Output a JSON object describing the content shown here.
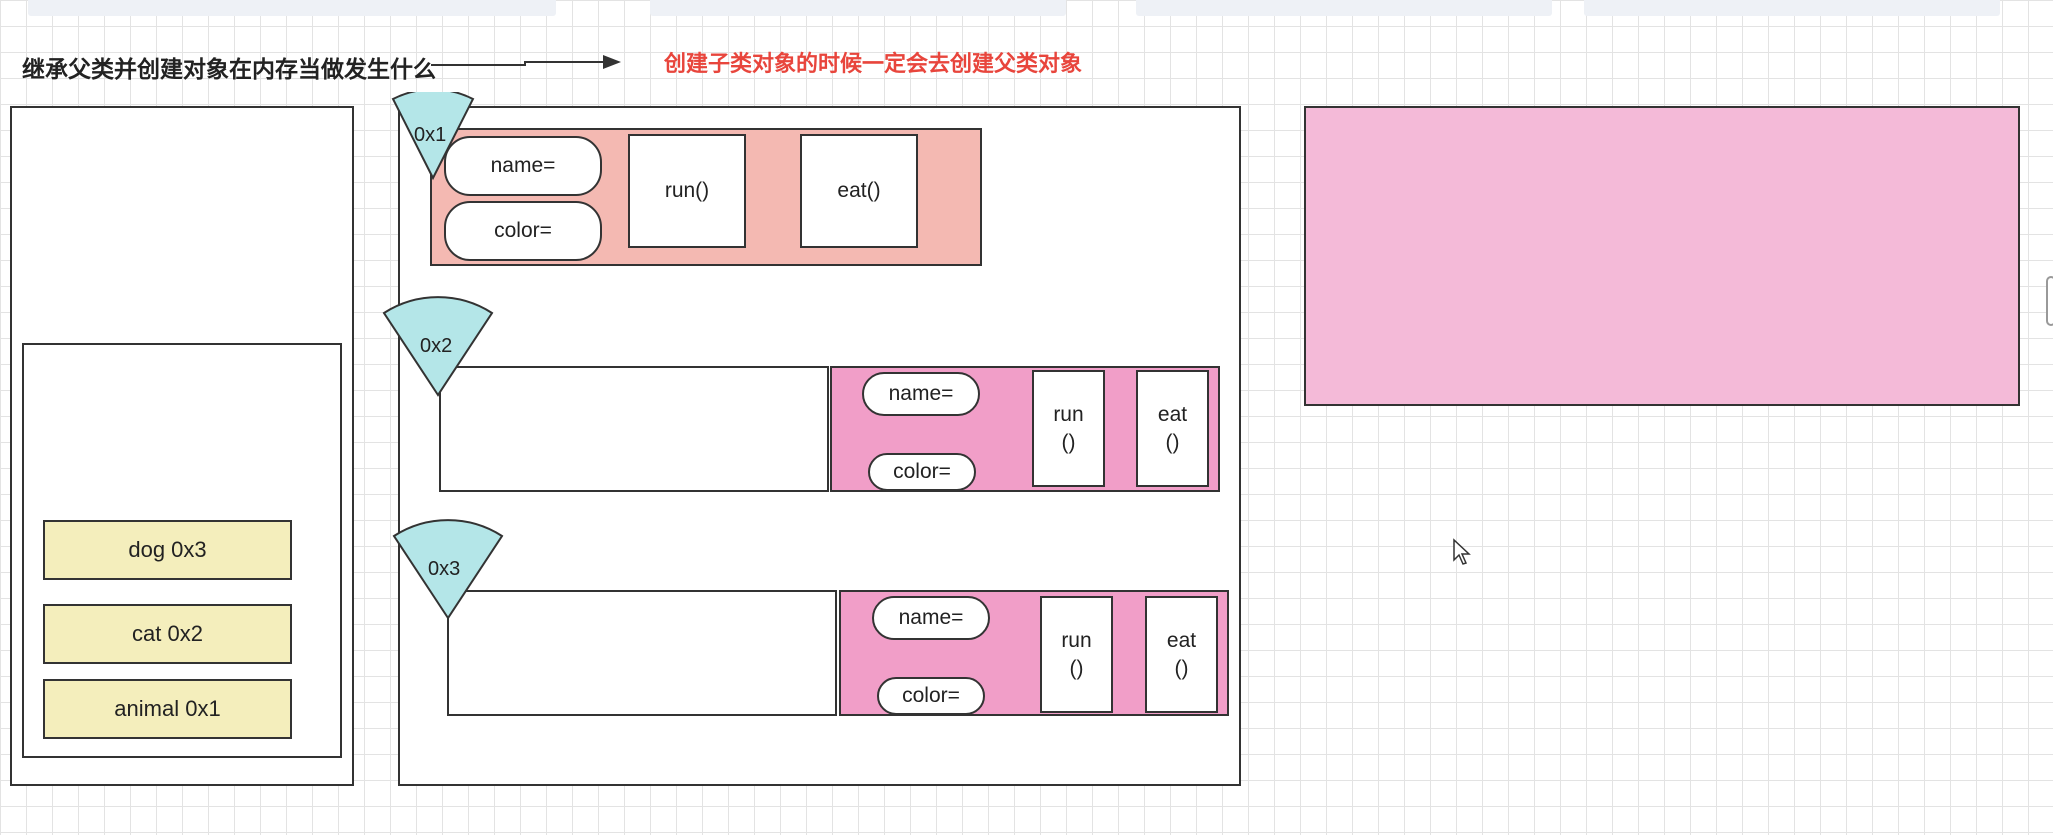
{
  "title": "继承父类并创建对象在内存当做发生什么",
  "note": "创建子类对象的时候一定会去创建父类对象",
  "stack_items": [
    "dog 0x3",
    "cat 0x2",
    "animal 0x1"
  ],
  "objects": [
    {
      "address": "0x1",
      "name_field": "name=",
      "color_field": "color=",
      "run": "run()",
      "eat": "eat()"
    },
    {
      "address": "0x2",
      "name_field": "name=",
      "color_field": "color=",
      "run": "run\n()",
      "eat": "eat\n()"
    },
    {
      "address": "0x3",
      "name_field": "name=",
      "color_field": "color=",
      "run": "run\n()",
      "eat": "eat\n()"
    }
  ],
  "colors": {
    "parent_object": "#f4b9b2",
    "child_parent_part": "#f19ec8",
    "pink_panel": "#f4bad8",
    "sector": "#b4e6e8",
    "stack_item": "#f4eebc",
    "note": "#e8453c"
  },
  "icons": [
    "cursor-arrow-icon"
  ]
}
